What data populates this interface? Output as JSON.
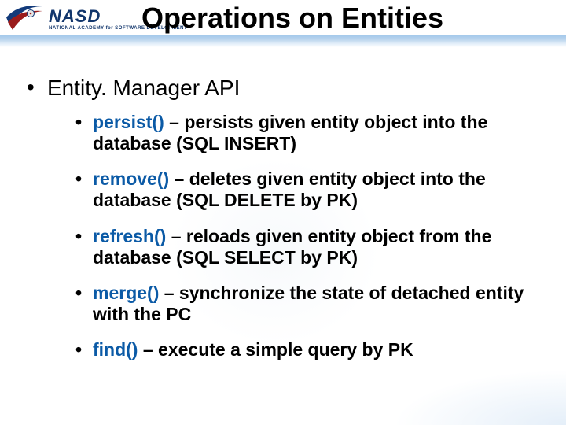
{
  "logo": {
    "main": "NASD",
    "sub": "NATIONAL ACADEMY for SOFTWARE DEVELOPMENT"
  },
  "title": "Operations on Entities",
  "heading_l1": "Entity. Manager API",
  "items": [
    {
      "method": "persist()",
      "desc": " – persists given entity object into the database (SQL INSERT)"
    },
    {
      "method": "remove()",
      "desc": " – deletes given entity object into the database (SQL DELETE by PK)"
    },
    {
      "method": "refresh()",
      "desc": " – reloads given entity object from the database (SQL SELECT by PK)"
    },
    {
      "method": "merge()",
      "desc": " – synchronize the state of detached entity with the PC"
    },
    {
      "method": "find()",
      "desc": " – execute a simple query by PK"
    }
  ]
}
